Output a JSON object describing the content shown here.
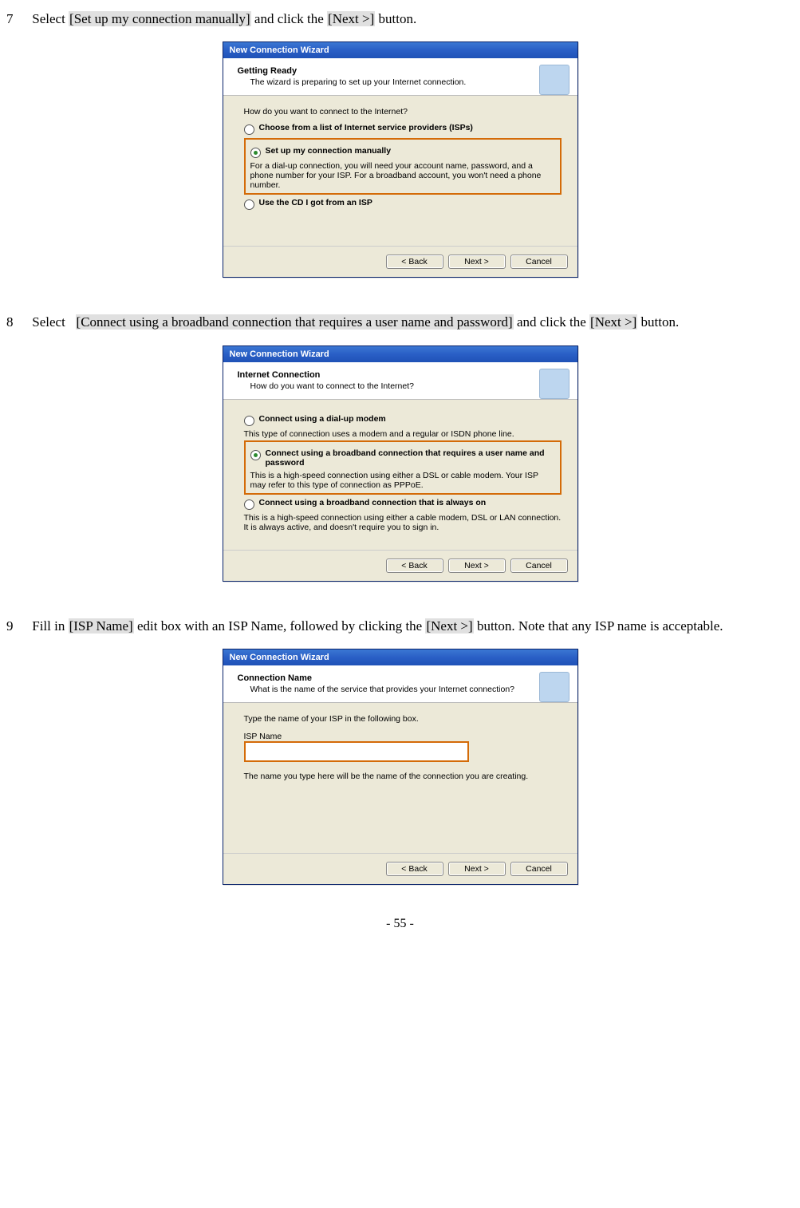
{
  "page_number": "- 55 -",
  "step7": {
    "num": "7",
    "pre": "Select ",
    "hl1": "[Set up my connection manually]",
    "mid": " and click the ",
    "hl2": "[Next >]",
    "post": " button."
  },
  "step8": {
    "num": "8",
    "pre": "Select ",
    "hl1": "[Connect using a broadband connection that requires a user name and password]",
    "mid": " and click the ",
    "hl2": "[Next >]",
    "post": " button."
  },
  "step9": {
    "num": "9",
    "pre": "Fill in ",
    "hl1": "[ISP Name]",
    "mid": " edit box with an ISP Name, followed by clicking the ",
    "hl2": "[Next >]",
    "post": " button. Note that any ISP name is acceptable."
  },
  "wiz_title": "New Connection Wizard",
  "btn_back": "< Back",
  "btn_next": "Next >",
  "btn_cancel": "Cancel",
  "wiz7": {
    "htitle": "Getting Ready",
    "hsub": "The wizard is preparing to set up your Internet connection.",
    "question": "How do you want to connect to the Internet?",
    "opt1_label": "Choose from a list of Internet service providers (ISPs)",
    "opt2_label": "Set up my connection manually",
    "opt2_desc": "For a dial-up connection, you will need your account name, password, and a phone number for your ISP. For a broadband account, you won't need a phone number.",
    "opt3_label": "Use the CD I got from an ISP"
  },
  "wiz8": {
    "htitle": "Internet Connection",
    "hsub": "How do you want to connect to the Internet?",
    "opt1_label": "Connect using a dial-up modem",
    "opt1_desc": "This type of connection uses a modem and a regular or ISDN phone line.",
    "opt2_label": "Connect using a broadband connection that requires a user name and password",
    "opt2_desc": "This is a high-speed connection using either a DSL or cable modem. Your ISP may refer to this type of connection as PPPoE.",
    "opt3_label": "Connect using a broadband connection that is always on",
    "opt3_desc": "This is a high-speed connection using either a cable modem, DSL or LAN connection. It is always active, and doesn't require you to sign in."
  },
  "wiz9": {
    "htitle": "Connection Name",
    "hsub": "What is the name of the service that provides your Internet connection?",
    "prompt": "Type the name of your ISP in the following box.",
    "label": "ISP Name",
    "value": "",
    "note": "The name you type here will be the name of the connection you are creating."
  }
}
